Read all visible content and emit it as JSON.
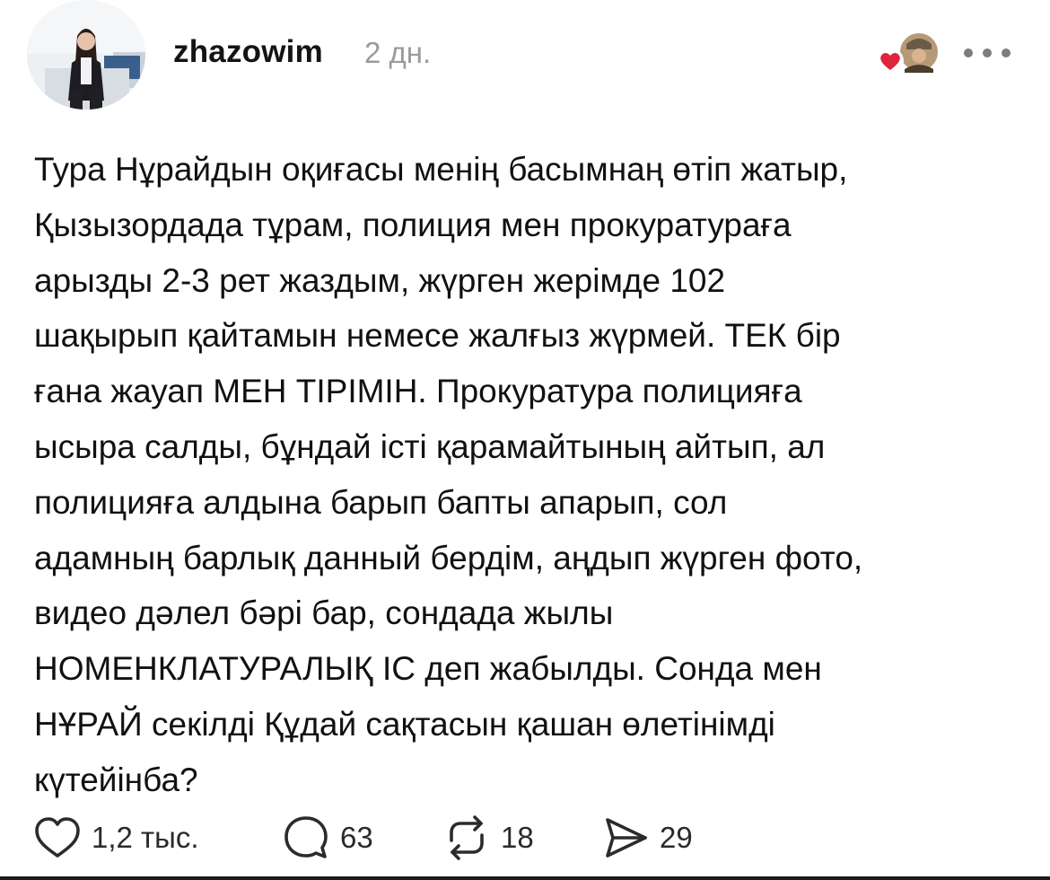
{
  "post": {
    "username": "zhazowim",
    "time": "2 дн.",
    "body_lines": [
      "Тура Нұрайдын оқиғасы менің басымнаң өтіп жатыр,",
      "Қызызордада тұрам, полиция мен прокуратураға",
      "арызды 2-3 рет жаздым, жүрген жерімде 102",
      "шақырып қайтамын немесе жалғыз жүрмей. ТЕК бір",
      "ғана жауап МЕН ТІРІМІН. Прокуратура полицияға",
      "ысыра салды, бұндай істі қарамайтының айтып, ал",
      "полицияға алдына барып бапты апарып, сол",
      "адамның барлық данный бердім, аңдып жүрген фото,",
      "видео дәлел бәрі бар, сондада жылы",
      "НОМЕНКЛАТУРАЛЫҚ ІС деп жабылды. Сонда мен",
      "НҰРАЙ секілді Құдай сақтасын қашан өлетінімді",
      "күтейінба?"
    ]
  },
  "actions": {
    "likes": "1,2 тыс.",
    "comments": "63",
    "reposts": "18",
    "shares": "29"
  },
  "icons": {
    "like": "heart-outline-icon",
    "comment": "speech-bubble-icon",
    "repost": "repost-arrows-icon",
    "share": "paper-plane-icon",
    "more": "more-dots-icon",
    "liked_badge": "red-heart-icon"
  },
  "colors": {
    "text": "#111111",
    "muted": "#9a9a9a",
    "heart": "#e0243c"
  }
}
